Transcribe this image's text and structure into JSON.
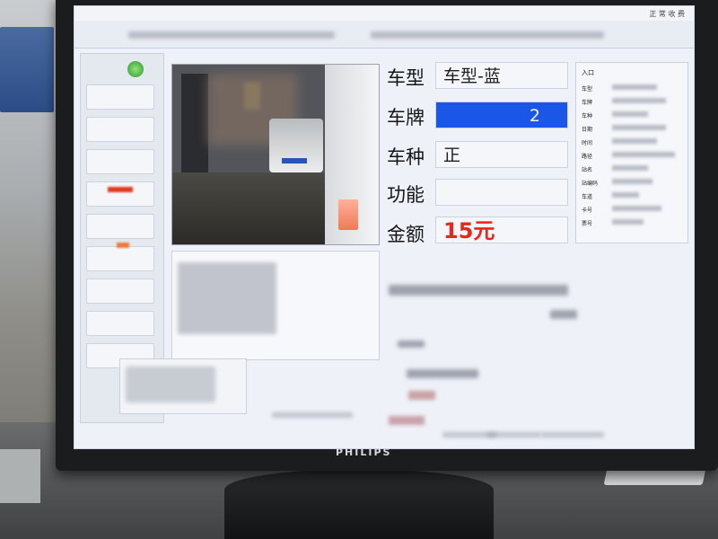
{
  "window": {
    "title": "",
    "corner_text": "正 常 收 费"
  },
  "left_panel": {
    "buttons": [
      "",
      "",
      "",
      "",
      "",
      "",
      "",
      "",
      "",
      ""
    ]
  },
  "camera": {
    "label": "",
    "image_description": "lane camera view"
  },
  "fields": [
    {
      "label": "车型",
      "value": "车型-蓝",
      "highlight": false
    },
    {
      "label": "车牌",
      "value": "2",
      "highlight": true
    },
    {
      "label": "车种",
      "value": "正",
      "highlight": false
    },
    {
      "label": "功能",
      "value": "",
      "highlight": false
    },
    {
      "label": "金额",
      "value": "15元",
      "highlight": false,
      "amount": true
    }
  ],
  "right_panel": {
    "title": "入口",
    "rows": [
      "车型",
      "车牌",
      "车种",
      "日期",
      "时间",
      "路径",
      "站名",
      "站编码",
      "车道",
      "卡号",
      "票号"
    ],
    "device_label": "",
    "special_event_label": ""
  },
  "log_panel": {
    "label": ""
  },
  "monitor": {
    "brand": "PHILIPS"
  },
  "colors": {
    "plate_blue": "#1b57e6",
    "amount_red": "#e8261c",
    "status_green": "#2d9a2b"
  }
}
